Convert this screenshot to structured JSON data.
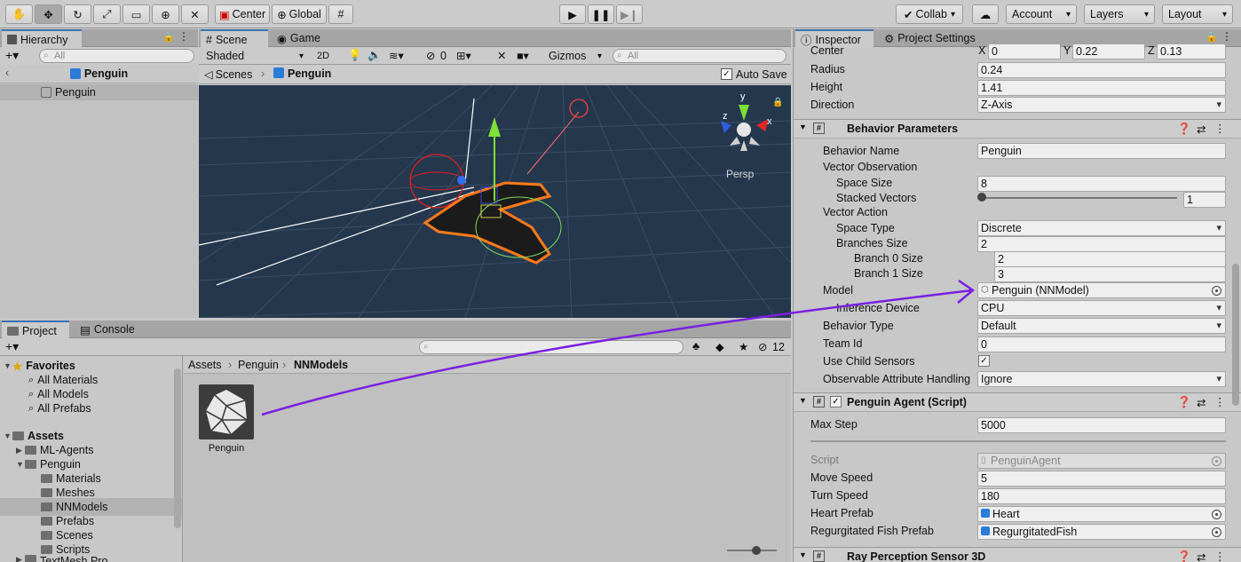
{
  "toolbar": {
    "tools": [
      "hand-tool",
      "move-tool",
      "rotate-tool",
      "scale-tool",
      "rect-tool",
      "transform-tool",
      "custom-tool"
    ],
    "pivot": "Center",
    "space": "Global",
    "collab": "Collab",
    "account": "Account",
    "layers": "Layers",
    "layout": "Layout"
  },
  "hierarchy": {
    "tab": "Hierarchy",
    "search_placeholder": "All",
    "scene_title": "Penguin",
    "items": [
      "Penguin"
    ]
  },
  "scene": {
    "tab_scene": "Scene",
    "tab_game": "Game",
    "shading": "Shaded",
    "mode_2d": "2D",
    "hidden_count": "0",
    "gizmos": "Gizmos",
    "search_placeholder": "All",
    "breadcrumb_root": "Scenes",
    "breadcrumb_current": "Penguin",
    "auto_save": "Auto Save",
    "persp": "Persp",
    "axis_x": "x",
    "axis_y": "y",
    "axis_z": "z"
  },
  "project": {
    "tab_project": "Project",
    "tab_console": "Console",
    "hidden_count": "12",
    "tree": {
      "favorites": "Favorites",
      "fav_items": [
        "All Materials",
        "All Models",
        "All Prefabs"
      ],
      "assets": "Assets",
      "ml_agents": "ML-Agents",
      "penguin": "Penguin",
      "penguin_children": [
        "Materials",
        "Meshes",
        "NNModels",
        "Prefabs",
        "Scenes",
        "Scripts"
      ],
      "cut_item": "TextMesh Pro"
    },
    "breadcrumb": [
      "Assets",
      "Penguin",
      "NNModels"
    ],
    "asset_label": "Penguin"
  },
  "inspector": {
    "tab_inspector": "Inspector",
    "tab_settings": "Project Settings",
    "collider": {
      "center_label": "Center",
      "center_x": "0",
      "center_y": "0.22",
      "center_z": "0.13",
      "radius_label": "Radius",
      "radius": "0.24",
      "height_label": "Height",
      "height": "1.41",
      "direction_label": "Direction",
      "direction": "Z-Axis"
    },
    "behavior": {
      "title": "Behavior Parameters",
      "name_label": "Behavior Name",
      "name": "Penguin",
      "vector_obs": "Vector Observation",
      "space_size_label": "Space Size",
      "space_size": "8",
      "stacked_label": "Stacked Vectors",
      "stacked": "1",
      "vector_action": "Vector Action",
      "space_type_label": "Space Type",
      "space_type": "Discrete",
      "branches_label": "Branches Size",
      "branches": "2",
      "branch0_label": "Branch 0 Size",
      "branch0": "2",
      "branch1_label": "Branch 1 Size",
      "branch1": "3",
      "model_label": "Model",
      "model": "Penguin (NNModel)",
      "inference_label": "Inference Device",
      "inference": "CPU",
      "btype_label": "Behavior Type",
      "btype": "Default",
      "team_label": "Team Id",
      "team": "0",
      "child_label": "Use Child Sensors",
      "observable_label": "Observable Attribute Handling",
      "observable": "Ignore"
    },
    "agent": {
      "title": "Penguin Agent (Script)",
      "max_step_label": "Max Step",
      "max_step": "5000",
      "script_label": "Script",
      "script": "PenguinAgent",
      "move_label": "Move Speed",
      "move": "5",
      "turn_label": "Turn Speed",
      "turn": "180",
      "heart_label": "Heart Prefab",
      "heart": "Heart",
      "fish_label": "Regurgitated Fish Prefab",
      "fish": "RegurgitatedFish"
    },
    "ray": {
      "title": "Ray Perception Sensor 3D"
    }
  },
  "colors": {
    "scene_bg": "#24374d",
    "selection_orange": "#ff7a1a",
    "arrow_purple": "#7a1fe0",
    "accent_blue": "#3a72b0"
  }
}
